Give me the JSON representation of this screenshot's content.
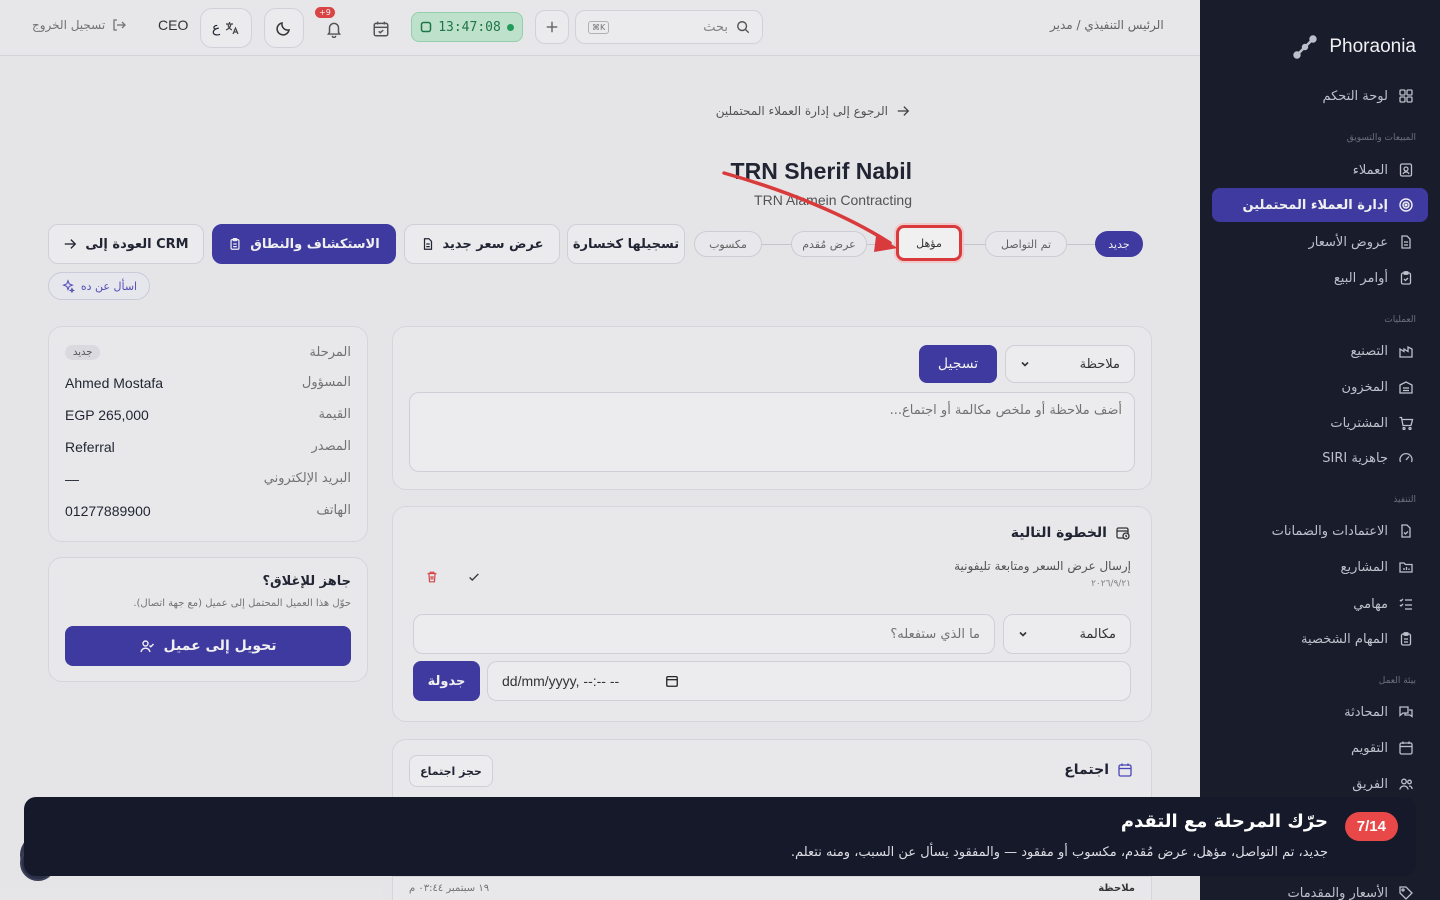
{
  "sidebar": {
    "brand": "Phoraonia",
    "items": [
      {
        "label": "لوحة التحكم"
      },
      {
        "label": "العملاء"
      },
      {
        "label": "إدارة العملاء المحتملين"
      },
      {
        "label": "عروض الأسعار"
      },
      {
        "label": "أوامر البيع"
      },
      {
        "label": "التصنيع"
      },
      {
        "label": "المخزون"
      },
      {
        "label": "المشتريات"
      },
      {
        "label": "جاهزية SIRI"
      },
      {
        "label": "الاعتمادات والضمانات"
      },
      {
        "label": "المشاريع"
      },
      {
        "label": "مهامي"
      },
      {
        "label": "المهام الشخصية"
      },
      {
        "label": "المحادثة"
      },
      {
        "label": "التقويم"
      },
      {
        "label": "الفريق"
      },
      {
        "label": "الأسعار والمقدمات"
      }
    ],
    "sections": {
      "sales": "المبيعات والتسويق",
      "ops": "العمليات",
      "exec": "التنفيذ",
      "work": "بيئة العمل"
    }
  },
  "topbar": {
    "breadcrumb": "الرئيس التنفيذي / مدير",
    "search_placeholder": "بحث",
    "search_kbd": "K⌘",
    "clock": "13:47:08",
    "notif_badge": "+9",
    "lang_label": "ع",
    "role": "CEO",
    "logout": "تسجيل الخروج"
  },
  "page": {
    "back_link": "الرجوع إلى إدارة العملاء المحتملين",
    "title": "TRN Sherif Nabil",
    "subtitle": "TRN Alamein Contracting"
  },
  "stages": {
    "new": "جديد",
    "contacted": "تم التواصل",
    "qualified": "مؤهل",
    "proposal": "عرض مُقدم",
    "won": "مكسوب"
  },
  "actions": {
    "record_loss": "تسجيلها كخسارة",
    "new_quote": "عرض سعر جديد",
    "discovery": "الاستكشاف والنطاق",
    "back_crm": "العودة إلى CRM",
    "ask": "اسأل عن ده"
  },
  "info_card": {
    "rows": [
      {
        "key": "المرحلة",
        "value": "جديد"
      },
      {
        "key": "المسؤول",
        "value": "Ahmed Mostafa"
      },
      {
        "key": "القيمة",
        "value": "EGP 265,000"
      },
      {
        "key": "المصدر",
        "value": "Referral"
      },
      {
        "key": "البريد الإلكتروني",
        "value": "—"
      },
      {
        "key": "الهاتف",
        "value": "01277889900"
      }
    ]
  },
  "close_card": {
    "title": "جاهز للإغلاق؟",
    "desc": "حوّل هذا العميل المحتمل إلى عميل (مع جهة اتصال).",
    "button": "تحويل إلى عميل"
  },
  "note_card": {
    "type": "ملاحظة",
    "submit": "تسجيل",
    "placeholder": "أضف ملاحظة أو ملخص مكالمة أو اجتماع..."
  },
  "next_step": {
    "title": "الخطوة التالية",
    "task": "إرسال عرض السعر ومتابعة تليفونية",
    "date": "٢٠٢٦/٩/٢١",
    "type": "مكالمة",
    "placeholder": "ما الذي ستفعله؟",
    "datetime": "dd/mm/yyyy, --:-- --",
    "schedule": "جدولة"
  },
  "meeting": {
    "title": "اجتماع",
    "book": "حجز اجتماع"
  },
  "tour": {
    "step": "7/14",
    "title": "حرّك المرحلة مع التقدم",
    "text": "جديد، تم التواصل، مؤهل، عرض مُقدم، مكسوب أو مفقود — والمفقود يسأل عن السبب، ومنه نتعلم."
  },
  "bottom": {
    "label": "ملاحظة",
    "date": "١٩ سبتمبر ٠٣:٤٤ م"
  },
  "colors": {
    "primary": "#3f3aa6",
    "sidebar": "#161a29",
    "highlight": "#e63b3b"
  }
}
